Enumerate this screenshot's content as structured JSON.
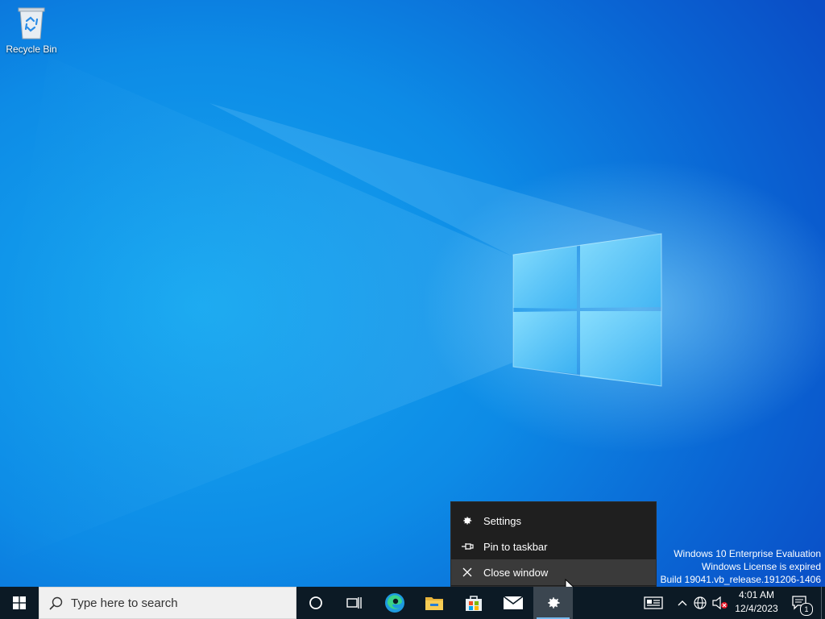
{
  "desktop": {
    "icons": [
      {
        "label": "Recycle Bin",
        "icon": "recycle-bin-icon"
      }
    ],
    "watermark": {
      "line1": "Windows 10 Enterprise Evaluation",
      "line2": "Windows License is expired",
      "line3": "Build 19041.vb_release.191206-1406"
    }
  },
  "context_menu": {
    "items": [
      {
        "label": "Settings",
        "icon": "gear-icon"
      },
      {
        "label": "Pin to taskbar",
        "icon": "pin-icon"
      },
      {
        "label": "Close window",
        "icon": "close-icon",
        "highlighted": true
      }
    ]
  },
  "taskbar": {
    "search_placeholder": "Type here to search",
    "apps": [
      {
        "name": "Cortana",
        "icon": "cortana-circle-icon"
      },
      {
        "name": "Task View",
        "icon": "task-view-icon"
      },
      {
        "name": "Microsoft Edge",
        "icon": "edge-icon"
      },
      {
        "name": "File Explorer",
        "icon": "folder-icon"
      },
      {
        "name": "Microsoft Store",
        "icon": "store-icon"
      },
      {
        "name": "Mail",
        "icon": "mail-icon"
      },
      {
        "name": "Settings",
        "icon": "gear-icon",
        "active": true
      }
    ],
    "clock": {
      "time": "4:01 AM",
      "date": "12/4/2023"
    },
    "notification_count": "1"
  },
  "colors": {
    "taskbar_bg": "#0c1a25",
    "menu_bg": "#1f1f1f",
    "menu_hover": "#3a3a3a",
    "accent": "#0078d7"
  }
}
